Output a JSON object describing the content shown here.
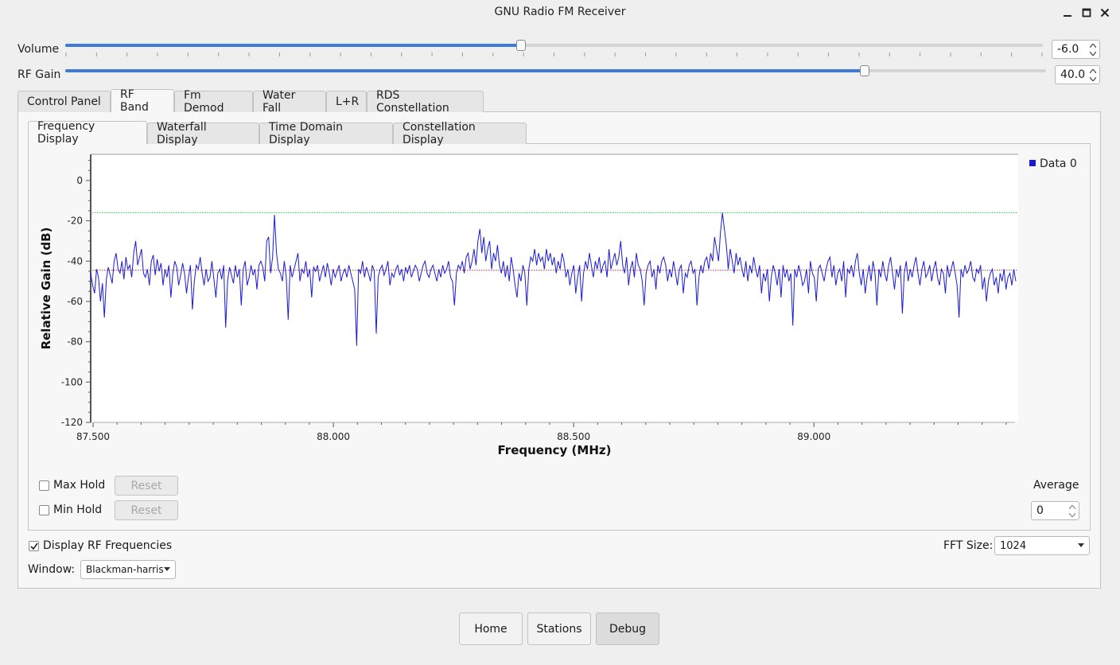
{
  "window": {
    "title": "GNU Radio FM Receiver"
  },
  "sliders": {
    "volume": {
      "label": "Volume",
      "value": "-6.0",
      "fraction": 0.466
    },
    "rf_gain": {
      "label": "RF Gain",
      "value": "40.0",
      "fraction": 0.815
    }
  },
  "main_tabs": [
    "Control Panel",
    "RF Band",
    "Fm Demod",
    "Water Fall",
    "L+R",
    "RDS Constellation"
  ],
  "main_tab_active": "RF Band",
  "sub_tabs": [
    "Frequency Display",
    "Waterfall Display",
    "Time Domain Display",
    "Constellation Display"
  ],
  "sub_tab_active": "Frequency Display",
  "chart_data": {
    "type": "line",
    "xlabel": "Frequency (MHz)",
    "ylabel": "Relative Gain (dB)",
    "xlim": [
      87.495,
      89.425
    ],
    "ylim": [
      -120,
      13
    ],
    "x_ticks": [
      "87.500",
      "88.000",
      "88.500",
      "89.000"
    ],
    "y_ticks": [
      "0",
      "-20",
      "-40",
      "-60",
      "-80",
      "-100",
      "-120"
    ],
    "legend": {
      "position": "top-right",
      "entries": [
        "Data 0"
      ]
    },
    "reference_lines": [
      {
        "name": "max",
        "y": -16,
        "color": "#3ccf3c"
      },
      {
        "name": "min",
        "y": -44.5,
        "color": "#b03030"
      }
    ],
    "series": [
      {
        "name": "Data 0",
        "color": "#1a1ad6",
        "x_start": 87.495,
        "x_end": 89.42,
        "values": [
          -46,
          -52,
          -56,
          -44,
          -48,
          -60,
          -51,
          -68,
          -49,
          -43,
          -47,
          -51,
          -40,
          -36,
          -44,
          -46,
          -40,
          -49,
          -38,
          -44,
          -42,
          -48,
          -36,
          -30,
          -42,
          -38,
          -34,
          -46,
          -48,
          -44,
          -52,
          -40,
          -37,
          -47,
          -39,
          -45,
          -41,
          -52,
          -44,
          -48,
          -42,
          -58,
          -46,
          -40,
          -43,
          -52,
          -47,
          -41,
          -46,
          -56,
          -48,
          -42,
          -64,
          -50,
          -42,
          -44,
          -38,
          -46,
          -52,
          -44,
          -50,
          -48,
          -40,
          -49,
          -58,
          -46,
          -44,
          -49,
          -42,
          -73,
          -50,
          -43,
          -47,
          -51,
          -42,
          -48,
          -44,
          -62,
          -44,
          -40,
          -52,
          -48,
          -42,
          -47,
          -44,
          -54,
          -42,
          -40,
          -43,
          -50,
          -30,
          -28,
          -46,
          -38,
          -17,
          -36,
          -44,
          -46,
          -50,
          -40,
          -48,
          -69,
          -42,
          -48,
          -44,
          -40,
          -36,
          -50,
          -44,
          -46,
          -40,
          -48,
          -44,
          -58,
          -43,
          -45,
          -42,
          -50,
          -46,
          -42,
          -48,
          -41,
          -46,
          -52,
          -44,
          -48,
          -45,
          -42,
          -50,
          -46,
          -44,
          -48,
          -42,
          -46,
          -50,
          -54,
          -82,
          -44,
          -46,
          -40,
          -48,
          -43,
          -46,
          -50,
          -42,
          -45,
          -76,
          -48,
          -44,
          -42,
          -47,
          -44,
          -40,
          -52,
          -46,
          -48,
          -44,
          -42,
          -47,
          -44,
          -50,
          -43,
          -46,
          -42,
          -48,
          -45,
          -42,
          -44,
          -50,
          -46,
          -42,
          -40,
          -46,
          -48,
          -44,
          -42,
          -46,
          -50,
          -44,
          -48,
          -42,
          -46,
          -44,
          -40,
          -48,
          -50,
          -62,
          -46,
          -42,
          -44,
          -40,
          -46,
          -38,
          -36,
          -44,
          -40,
          -34,
          -42,
          -30,
          -24,
          -36,
          -28,
          -40,
          -34,
          -30,
          -44,
          -36,
          -40,
          -32,
          -42,
          -46,
          -40,
          -48,
          -42,
          -50,
          -38,
          -44,
          -52,
          -58,
          -46,
          -50,
          -42,
          -46,
          -62,
          -44,
          -38,
          -40,
          -34,
          -42,
          -36,
          -40,
          -38,
          -44,
          -34,
          -40,
          -36,
          -42,
          -38,
          -46,
          -40,
          -44,
          -36,
          -40,
          -48,
          -44,
          -52,
          -46,
          -42,
          -56,
          -48,
          -42,
          -60,
          -46,
          -40,
          -44,
          -36,
          -42,
          -48,
          -40,
          -44,
          -38,
          -46,
          -42,
          -40,
          -48,
          -34,
          -44,
          -40,
          -36,
          -42,
          -38,
          -30,
          -42,
          -46,
          -38,
          -52,
          -44,
          -40,
          -48,
          -36,
          -42,
          -44,
          -50,
          -62,
          -46,
          -42,
          -40,
          -48,
          -44,
          -54,
          -42,
          -46,
          -40,
          -38,
          -42,
          -50,
          -44,
          -48,
          -40,
          -46,
          -52,
          -44,
          -42,
          -56,
          -46,
          -48,
          -42,
          -40,
          -46,
          -44,
          -62,
          -48,
          -42,
          -46,
          -40,
          -38,
          -44,
          -36,
          -40,
          -28,
          -34,
          -40,
          -26,
          -16,
          -24,
          -32,
          -44,
          -34,
          -40,
          -46,
          -36,
          -42,
          -38,
          -44,
          -48,
          -40,
          -50,
          -42,
          -46,
          -38,
          -44,
          -48,
          -42,
          -56,
          -46,
          -50,
          -44,
          -60,
          -48,
          -42,
          -46,
          -52,
          -44,
          -58,
          -42,
          -48,
          -44,
          -50,
          -46,
          -72,
          -44,
          -48,
          -42,
          -46,
          -52,
          -50,
          -44,
          -56,
          -40,
          -46,
          -48,
          -60,
          -44,
          -42,
          -46,
          -50,
          -44,
          -40,
          -38,
          -48,
          -42,
          -52,
          -46,
          -44,
          -50,
          -40,
          -58,
          -44,
          -46,
          -42,
          -48,
          -40,
          -36,
          -46,
          -52,
          -44,
          -56,
          -48,
          -42,
          -50,
          -40,
          -46,
          -62,
          -44,
          -48,
          -40,
          -46,
          -50,
          -42,
          -38,
          -46,
          -54,
          -44,
          -48,
          -42,
          -66,
          -46,
          -40,
          -50,
          -44,
          -48,
          -42,
          -38,
          -46,
          -52,
          -44,
          -40,
          -48,
          -46,
          -42,
          -50,
          -44,
          -40,
          -48,
          -52,
          -44,
          -46,
          -56,
          -42,
          -48,
          -44,
          -40,
          -46,
          -52,
          -68,
          -44,
          -48,
          -42,
          -46,
          -44,
          -40,
          -48,
          -50,
          -44,
          -46,
          -42,
          -54,
          -48,
          -60,
          -50,
          -46,
          -44,
          -52,
          -48,
          -56,
          -46,
          -50,
          -44,
          -54,
          -48,
          -46,
          -52,
          -44,
          -50
        ]
      }
    ]
  },
  "legend_label": "Data 0",
  "controls": {
    "max_hold_label": "Max Hold",
    "min_hold_label": "Min Hold",
    "reset_label": "Reset",
    "average_label": "Average",
    "average_value": "0",
    "display_rf_label": "Display RF Frequencies",
    "display_rf_checked": true,
    "fft_size_label": "FFT Size:",
    "fft_size_value": "1024",
    "window_label": "Window:",
    "window_value": "Blackman-harris"
  },
  "bottom_buttons": [
    "Home",
    "Stations",
    "Debug"
  ]
}
